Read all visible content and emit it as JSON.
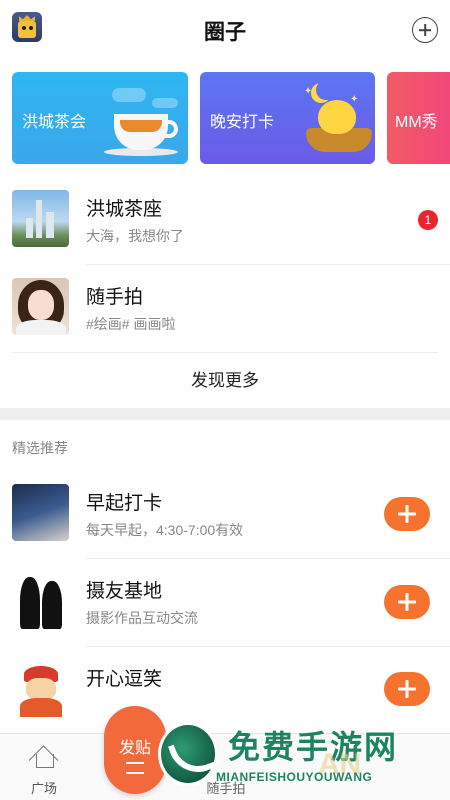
{
  "header": {
    "title": "圈子"
  },
  "banners": [
    {
      "label": "洪城茶会"
    },
    {
      "label": "晚安打卡"
    },
    {
      "label": "MM秀"
    }
  ],
  "circles": [
    {
      "name": "洪城茶座",
      "desc": "大海，我想你了",
      "badge": "1"
    },
    {
      "name": "随手拍",
      "desc": "#绘画# 画画啦"
    }
  ],
  "discover_more": "发现更多",
  "recommend": {
    "section_title": "精选推荐",
    "items": [
      {
        "name": "早起打卡",
        "desc": "每天早起，4:30-7:00有效"
      },
      {
        "name": "摄友基地",
        "desc": "摄影作品互动交流"
      },
      {
        "name": "开心逗笑",
        "desc": ""
      }
    ]
  },
  "tabbar": {
    "tabs": [
      {
        "label": "广场",
        "icon": "home-icon"
      },
      {
        "label": "随手拍",
        "icon": "camera-icon"
      }
    ],
    "post_label": "发贴"
  },
  "watermark": {
    "title": "免费手游网",
    "sub": "MIANFEISHOUYOUWANG",
    "brand": "AN"
  },
  "colors": {
    "accent": "#f5732f",
    "badge": "#e8262e",
    "watermark": "#1c8560"
  }
}
